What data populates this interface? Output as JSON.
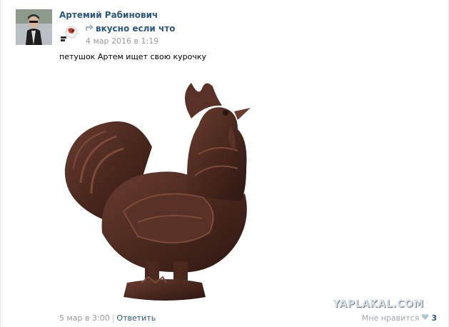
{
  "post": {
    "author": "Артемий Рабинович",
    "repost": {
      "source_name": "вкусно если что",
      "date": "4 мар 2016 в 1:19"
    },
    "text": "петушок Артем ищет свою курочку",
    "footer": {
      "date": "5 мар в 3:00",
      "separator": "|",
      "reply": "Ответить",
      "like_label": "Мне нравится",
      "like_count": "3"
    }
  },
  "watermark": "YAPLAKAL.COM",
  "icons": [
    "repost-arrow-icon",
    "heart-icon"
  ],
  "colors": {
    "link": "#2b587a",
    "muted": "#999999",
    "chocolate": "#4a2a20"
  }
}
